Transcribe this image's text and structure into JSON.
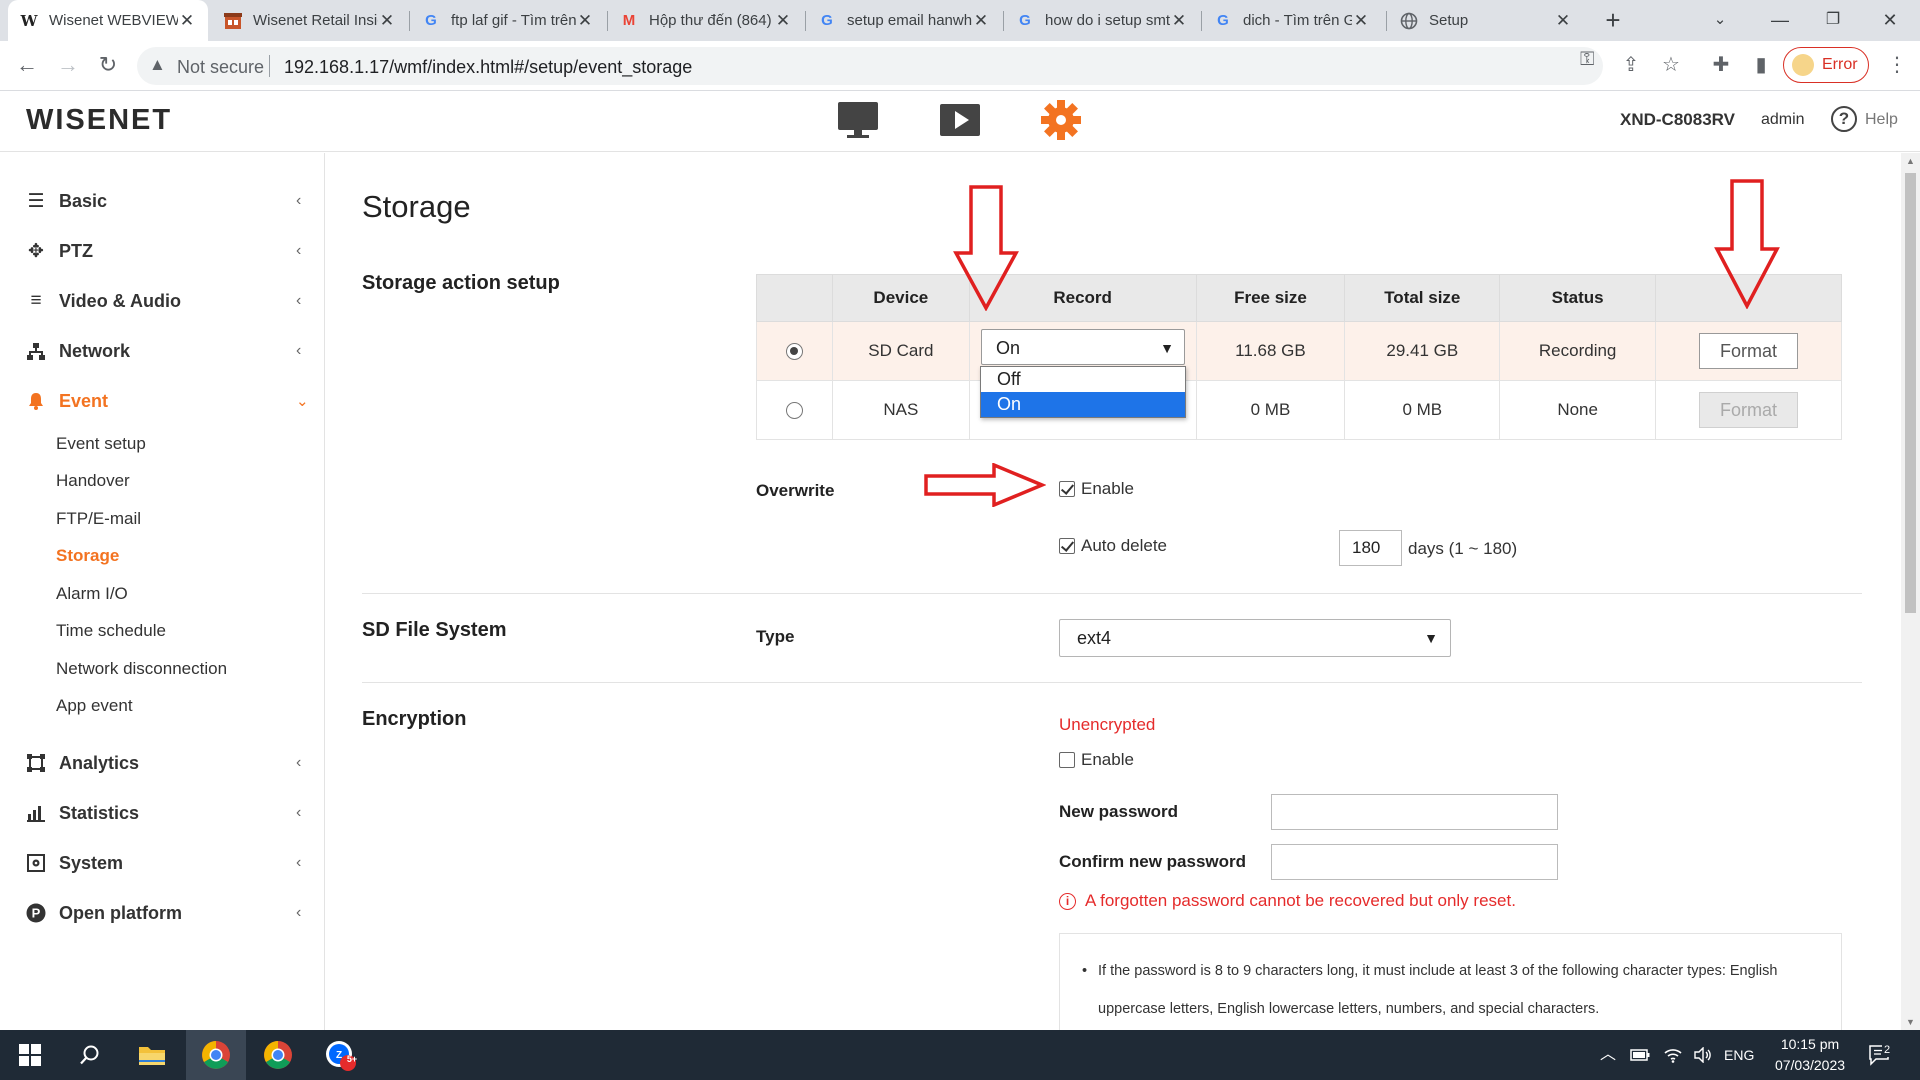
{
  "browser": {
    "tabs": [
      {
        "title": "Wisenet WEBVIEW",
        "favicon": "W",
        "active": true
      },
      {
        "title": "Wisenet Retail Insight",
        "favicon": "retail-icon",
        "active": false
      },
      {
        "title": "ftp laf gif - Tìm trên Google",
        "favicon": "G",
        "active": false
      },
      {
        "title": "Hộp thư đến (864)",
        "favicon": "M",
        "active": false
      },
      {
        "title": "setup email hanwha",
        "favicon": "G",
        "active": false
      },
      {
        "title": "how do i setup smtp",
        "favicon": "G",
        "active": false
      },
      {
        "title": "dich - Tìm trên Google",
        "favicon": "G",
        "active": false
      },
      {
        "title": "Setup",
        "favicon": "globe-icon",
        "active": false
      }
    ],
    "security_label": "Not secure",
    "url": "192.168.1.17/wmf/index.html#/setup/event_storage",
    "profile_status": "Error"
  },
  "header": {
    "logo": "WISENET",
    "model": "XND-C8083RV",
    "user": "admin",
    "help_label": "Help",
    "accent_color": "#f37321"
  },
  "sidebar": {
    "menus": [
      {
        "label": "Basic",
        "icon": "list-icon"
      },
      {
        "label": "PTZ",
        "icon": "move-icon"
      },
      {
        "label": "Video & Audio",
        "icon": "sliders-icon"
      },
      {
        "label": "Network",
        "icon": "network-icon"
      },
      {
        "label": "Event",
        "icon": "bell-icon"
      },
      {
        "label": "Analytics",
        "icon": "frame-icon"
      },
      {
        "label": "Statistics",
        "icon": "bar-chart-icon"
      },
      {
        "label": "System",
        "icon": "gear-box-icon"
      },
      {
        "label": "Open platform",
        "icon": "p-circle-icon"
      }
    ],
    "event_submenu": [
      "Event setup",
      "Handover",
      "FTP/E-mail",
      "Storage",
      "Alarm I/O",
      "Time schedule",
      "Network disconnection",
      "App event"
    ],
    "active_submenu": "Storage"
  },
  "page": {
    "title": "Storage",
    "sections": {
      "action_setup": "Storage action setup",
      "sd_fs": "SD File System",
      "encryption": "Encryption"
    },
    "table": {
      "headers": [
        "",
        "Device",
        "Record",
        "Free size",
        "Total size",
        "Status",
        ""
      ],
      "rows": [
        {
          "device": "SD Card",
          "record": "On",
          "free": "11.68 GB",
          "total": "29.41 GB",
          "status": "Recording",
          "action": "Format",
          "selected": true
        },
        {
          "device": "NAS",
          "record": "",
          "free": "0 MB",
          "total": "0 MB",
          "status": "None",
          "action": "Format",
          "selected": false
        }
      ]
    },
    "record_dropdown": {
      "options": [
        "Off",
        "On"
      ],
      "highlighted": "On"
    },
    "overwrite": {
      "label": "Overwrite",
      "enable_label": "Enable",
      "auto_delete_label": "Auto delete",
      "days_value": "180",
      "days_suffix": "days (1 ~ 180)"
    },
    "filesystem": {
      "type_label": "Type",
      "type_value": "ext4"
    },
    "encryption": {
      "status": "Unencrypted",
      "enable_label": "Enable",
      "new_password_label": "New password",
      "confirm_password_label": "Confirm new password",
      "warning": "A forgotten password cannot be recovered but only reset.",
      "rule_line1": "If the password is 8 to 9 characters long, it must include at least 3 of the following character types: English",
      "rule_line2": "uppercase letters, English lowercase letters, numbers, and special characters."
    }
  },
  "taskbar": {
    "language": "ENG",
    "time": "10:15 pm",
    "date": "07/03/2023",
    "notifications": "2",
    "zalo_badge": "5+"
  }
}
